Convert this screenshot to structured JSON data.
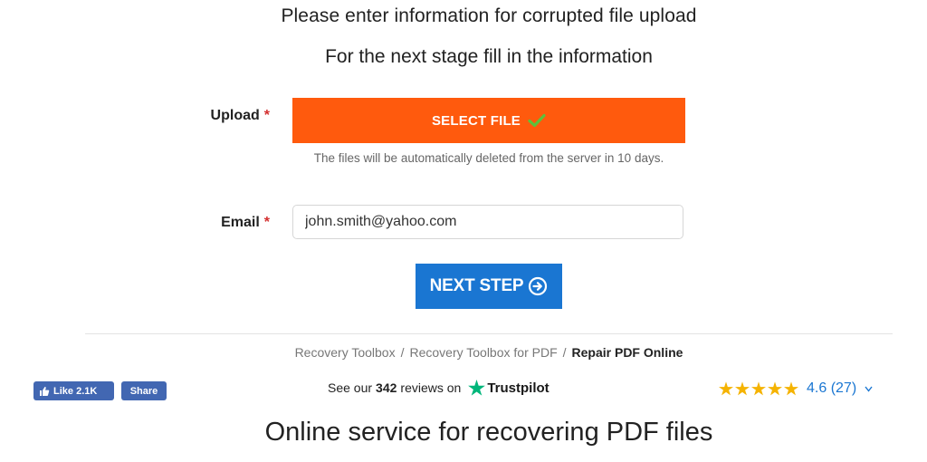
{
  "headings": {
    "title": "Please enter information for corrupted file upload",
    "subtitle": "For the next stage fill in the information"
  },
  "upload": {
    "label": "Upload",
    "required_mark": "*",
    "button_label": "SELECT FILE",
    "hint": "The files will be automatically deleted from the server in 10 days."
  },
  "email": {
    "label": "Email",
    "required_mark": "*",
    "value": "john.smith@yahoo.com"
  },
  "next_step": {
    "label": "NEXT STEP"
  },
  "breadcrumb": {
    "items": [
      "Recovery Toolbox",
      "Recovery Toolbox for PDF"
    ],
    "current": "Repair PDF Online",
    "separator": "/"
  },
  "social": {
    "like_label": "Like",
    "like_count": "2.1K",
    "share_label": "Share"
  },
  "trustpilot": {
    "prefix": "See our",
    "count": "342",
    "suffix": "reviews on",
    "brand": "Trustpilot"
  },
  "rating": {
    "stars": 5,
    "value_text": "4.6 (27)"
  },
  "main_title": "Online service for recovering PDF files",
  "colors": {
    "select_button": "#ff5a0d",
    "next_button": "#1a76d2",
    "check": "#5cc23c",
    "star": "#f5b301",
    "trustpilot_star": "#00b67a",
    "facebook": "#4267b2"
  },
  "icons": {
    "check": "check-icon",
    "arrow": "arrow-circle-right-icon",
    "thumb": "thumbs-up-icon",
    "trustpilot": "trustpilot-star-icon",
    "rating_star": "star-icon",
    "caret": "caret-down-icon"
  }
}
